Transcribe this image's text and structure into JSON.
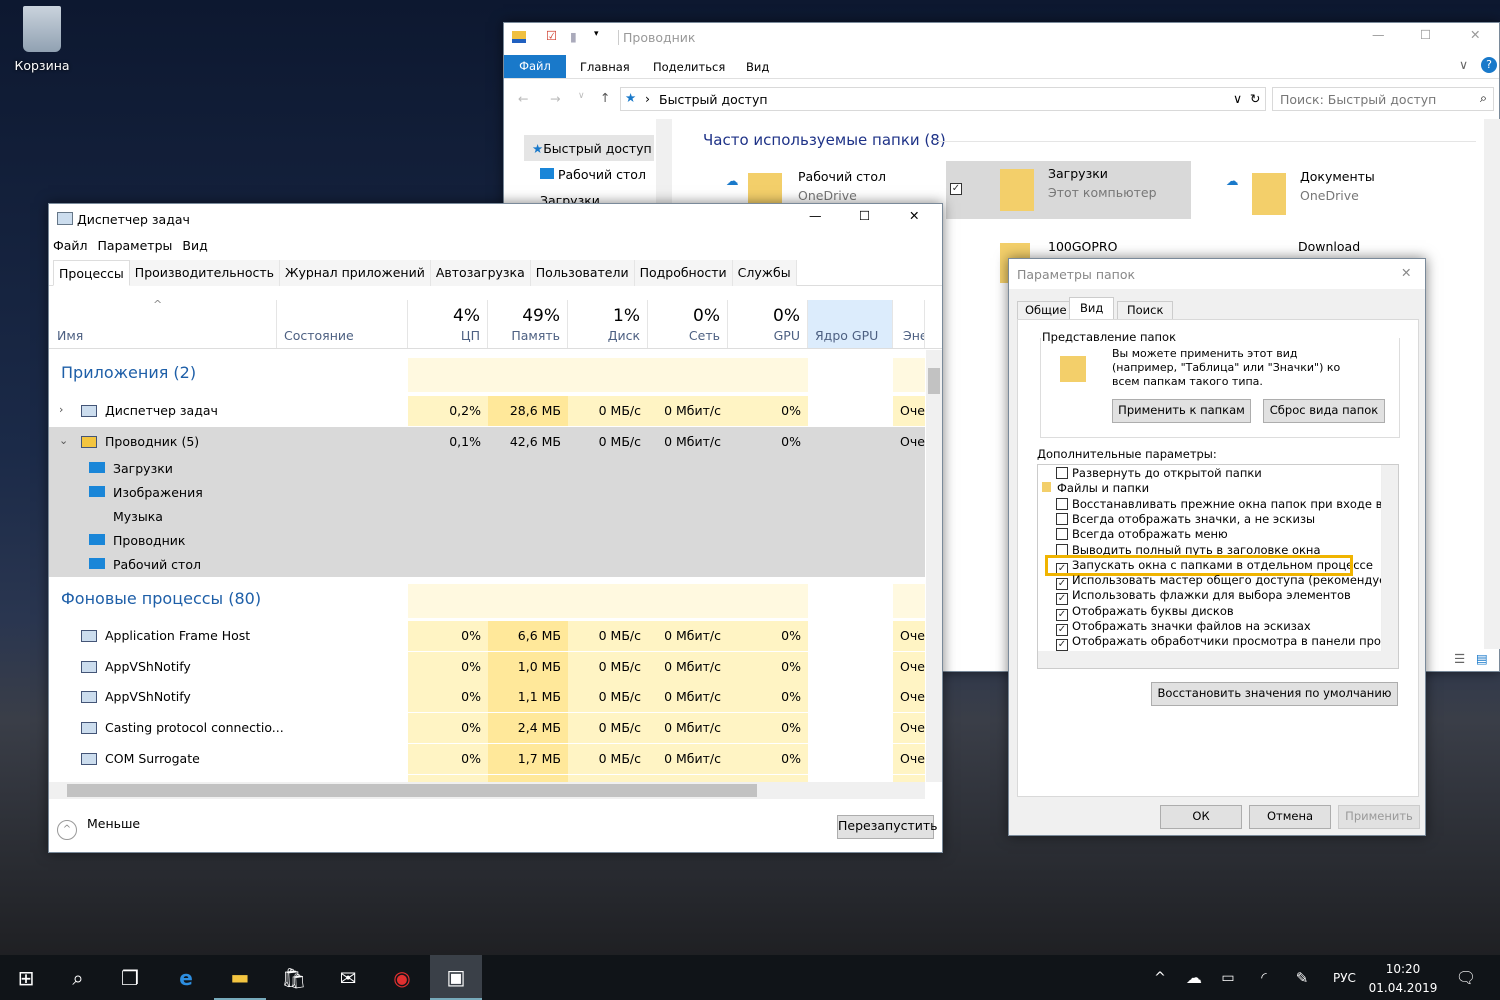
{
  "desktop": {
    "recycle_bin": "Корзина"
  },
  "explorer": {
    "title": "Проводник",
    "ribbon_tabs": [
      "Файл",
      "Главная",
      "Поделиться",
      "Вид"
    ],
    "address": "Быстрый доступ",
    "search_placeholder": "Поиск: Быстрый доступ",
    "nav": [
      "Быстрый доступ",
      "Рабочий стол",
      "Загрузки"
    ],
    "section": "Часто используемые папки (8)",
    "folders": [
      {
        "name": "Рабочий стол",
        "sub": "OneDrive"
      },
      {
        "name": "Загрузки",
        "sub": "Этот компьютер"
      },
      {
        "name": "Документы",
        "sub": "OneDrive"
      },
      {
        "name": "100GOPRO",
        "sub": ""
      },
      {
        "name": "Download",
        "sub": ""
      }
    ]
  },
  "taskmgr": {
    "title": "Диспетчер задач",
    "menu": [
      "Файл",
      "Параметры",
      "Вид"
    ],
    "tabs": [
      "Процессы",
      "Производительность",
      "Журнал приложений",
      "Автозагрузка",
      "Пользователи",
      "Подробности",
      "Службы"
    ],
    "columns": {
      "name": "Имя",
      "status": "Состояние",
      "cpu_pct": "4%",
      "cpu": "ЦП",
      "mem_pct": "49%",
      "mem": "Память",
      "disk_pct": "1%",
      "disk": "Диск",
      "net_pct": "0%",
      "net": "Сеть",
      "gpu_pct": "0%",
      "gpu": "GPU",
      "gpu_core": "Ядро GPU",
      "power": "Энерго"
    },
    "apps_group": "Приложения (2)",
    "apps": [
      {
        "name": "Диспетчер задач",
        "cpu": "0,2%",
        "mem": "28,6 МБ",
        "disk": "0 МБ/с",
        "net": "0 Мбит/с",
        "gpu": "0%",
        "power": "Оче"
      },
      {
        "name": "Проводник (5)",
        "cpu": "0,1%",
        "mem": "42,6 МБ",
        "disk": "0 МБ/с",
        "net": "0 Мбит/с",
        "gpu": "0%",
        "power": "Оче"
      }
    ],
    "explorer_children": [
      "Загрузки",
      "Изображения",
      "Музыка",
      "Проводник",
      "Рабочий стол"
    ],
    "bg_group": "Фоновые процессы (80)",
    "bg": [
      {
        "name": "Application Frame Host",
        "cpu": "0%",
        "mem": "6,6 МБ",
        "disk": "0 МБ/с",
        "net": "0 Мбит/с",
        "gpu": "0%",
        "power": "Оче"
      },
      {
        "name": "AppVShNotify",
        "cpu": "0%",
        "mem": "1,0 МБ",
        "disk": "0 МБ/с",
        "net": "0 Мбит/с",
        "gpu": "0%",
        "power": "Оче"
      },
      {
        "name": "AppVShNotify",
        "cpu": "0%",
        "mem": "1,1 МБ",
        "disk": "0 МБ/с",
        "net": "0 Мбит/с",
        "gpu": "0%",
        "power": "Оче"
      },
      {
        "name": "Casting protocol connectio...",
        "cpu": "0%",
        "mem": "2,4 МБ",
        "disk": "0 МБ/с",
        "net": "0 Мбит/с",
        "gpu": "0%",
        "power": "Оче"
      },
      {
        "name": "COM Surrogate",
        "cpu": "0%",
        "mem": "1,7 МБ",
        "disk": "0 МБ/с",
        "net": "0 Мбит/с",
        "gpu": "0%",
        "power": "Оче"
      }
    ],
    "less": "Меньше",
    "restart": "Перезапустить"
  },
  "folder_options": {
    "title": "Параметры папок",
    "tabs": [
      "Общие",
      "Вид",
      "Поиск"
    ],
    "active_tab": "Вид",
    "view_group": "Представление папок",
    "view_text": "Вы можете применить этот вид (например, \"Таблица\" или \"Значки\") ко всем папкам такого типа.",
    "apply_folders": "Применить к папкам",
    "reset_folders": "Сброс вида папок",
    "advanced": "Дополнительные параметры:",
    "items": [
      {
        "label": "Развернуть до открытой папки",
        "checked": false
      },
      {
        "label": "Файлы и папки",
        "folder": true
      },
      {
        "label": "Восстанавливать прежние окна папок при входе в систему",
        "checked": false
      },
      {
        "label": "Всегда отображать значки, а не эскизы",
        "checked": false
      },
      {
        "label": "Всегда отображать меню",
        "checked": false
      },
      {
        "label": "Выводить полный путь в заголовке окна",
        "checked": false
      },
      {
        "label": "Запускать окна с папками в отдельном процессе",
        "checked": true,
        "highlight": true
      },
      {
        "label": "Использовать мастер общего доступа (рекомендуется)",
        "checked": true
      },
      {
        "label": "Использовать флажки для выбора элементов",
        "checked": true
      },
      {
        "label": "Отображать буквы дисков",
        "checked": true
      },
      {
        "label": "Отображать значки файлов на эскизах",
        "checked": true
      },
      {
        "label": "Отображать обработчики просмотра в панели просмотра",
        "checked": true
      }
    ],
    "highlight_color": "#f0b400",
    "restore_defaults": "Восстановить значения по умолчанию",
    "ok": "ОК",
    "cancel": "Отмена",
    "apply": "Применить"
  },
  "taskbar": {
    "lang": "РУС",
    "time": "10:20",
    "date": "01.04.2019"
  }
}
